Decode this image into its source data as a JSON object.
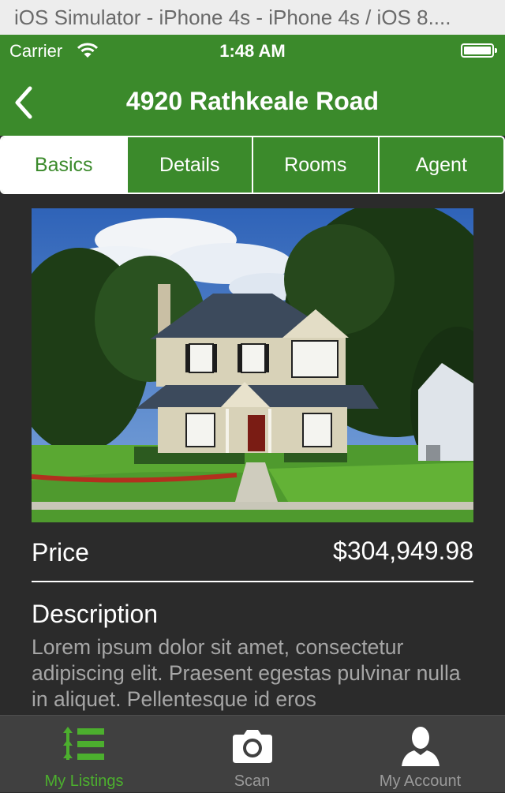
{
  "simulator": {
    "title": "iOS Simulator - iPhone 4s - iPhone 4s / iOS 8...."
  },
  "status_bar": {
    "carrier": "Carrier",
    "time": "1:48 AM"
  },
  "nav": {
    "title": "4920 Rathkeale Road",
    "back_icon": "chevron-left-icon"
  },
  "segments": [
    {
      "label": "Basics",
      "selected": true
    },
    {
      "label": "Details",
      "selected": false
    },
    {
      "label": "Rooms",
      "selected": false
    },
    {
      "label": "Agent",
      "selected": false
    }
  ],
  "listing": {
    "price_label": "Price",
    "price_value": "$304,949.98",
    "description_heading": "Description",
    "description_text": "Lorem ipsum dolor sit amet, consectetur adipiscing elit. Praesent egestas pulvinar nulla in aliquet. Pellentesque id eros"
  },
  "tabs": [
    {
      "label": "My Listings",
      "icon": "list-icon",
      "selected": true
    },
    {
      "label": "Scan",
      "icon": "camera-icon",
      "selected": false
    },
    {
      "label": "My Account",
      "icon": "person-icon",
      "selected": false
    }
  ],
  "colors": {
    "accent": "#3b8a2b",
    "tab_active": "#4caf2e",
    "background": "#2b2b2b"
  }
}
